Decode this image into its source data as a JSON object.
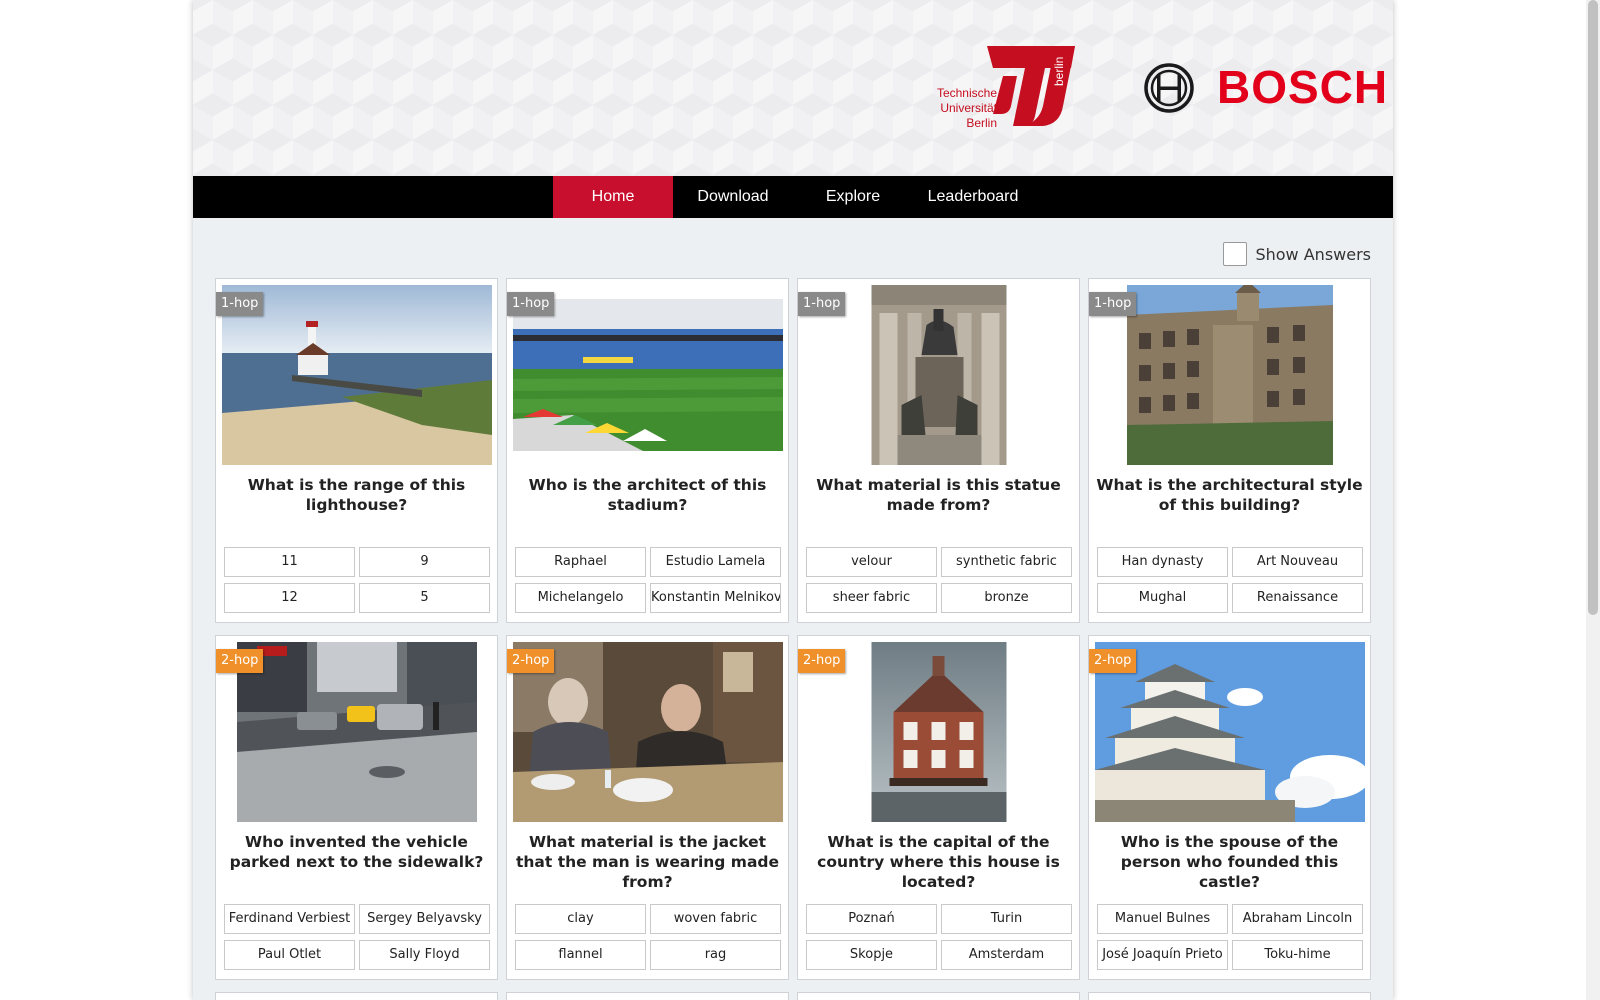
{
  "logos": {
    "tu_text": [
      "Technische",
      "Universität",
      "Berlin"
    ],
    "tu_side": "berlin",
    "bosch": "BOSCH"
  },
  "nav": {
    "items": [
      {
        "label": "Home",
        "active": true
      },
      {
        "label": "Download",
        "active": false
      },
      {
        "label": "Explore",
        "active": false
      },
      {
        "label": "Leaderboard",
        "active": false
      }
    ]
  },
  "show_answers": {
    "label": "Show Answers",
    "checked": false
  },
  "colors": {
    "accent": "#c8102e",
    "one_hop": "#8a8a8a",
    "two_hop": "#f0902a",
    "bosch_red": "#e2001a"
  },
  "cards": [
    {
      "hop": "1-hop",
      "image": "lighthouse",
      "question": "What is the range of this lighthouse?",
      "options": [
        "11",
        "9",
        "12",
        "5"
      ]
    },
    {
      "hop": "1-hop",
      "image": "stadium",
      "question": "Who is the architect of this stadium?",
      "options": [
        "Raphael",
        "Estudio Lamela",
        "Michelangelo",
        "Konstantin Melnikov"
      ]
    },
    {
      "hop": "1-hop",
      "image": "statue",
      "question": "What material is this statue made from?",
      "options": [
        "velour",
        "synthetic fabric",
        "sheer fabric",
        "bronze"
      ]
    },
    {
      "hop": "1-hop",
      "image": "building",
      "question": "What is the architectural style of this building?",
      "options": [
        "Han dynasty",
        "Art Nouveau",
        "Mughal",
        "Renaissance"
      ]
    },
    {
      "hop": "2-hop",
      "image": "street",
      "question": "Who invented the vehicle parked next to the sidewalk?",
      "options": [
        "Ferdinand Verbiest",
        "Sergey Belyavsky",
        "Paul Otlet",
        "Sally Floyd"
      ]
    },
    {
      "hop": "2-hop",
      "image": "dinner",
      "question": "What material is the jacket that the man is wearing made from?",
      "options": [
        "clay",
        "woven fabric",
        "flannel",
        "rag"
      ]
    },
    {
      "hop": "2-hop",
      "image": "house",
      "question": "What is the capital of the country where this house is located?",
      "options": [
        "Poznań",
        "Turin",
        "Skopje",
        "Amsterdam"
      ]
    },
    {
      "hop": "2-hop",
      "image": "castle",
      "question": "Who is the spouse of the person who founded this castle?",
      "options": [
        "Manuel Bulnes",
        "Abraham Lincoln",
        "José Joaquín Prieto",
        "Toku-hime"
      ]
    }
  ]
}
